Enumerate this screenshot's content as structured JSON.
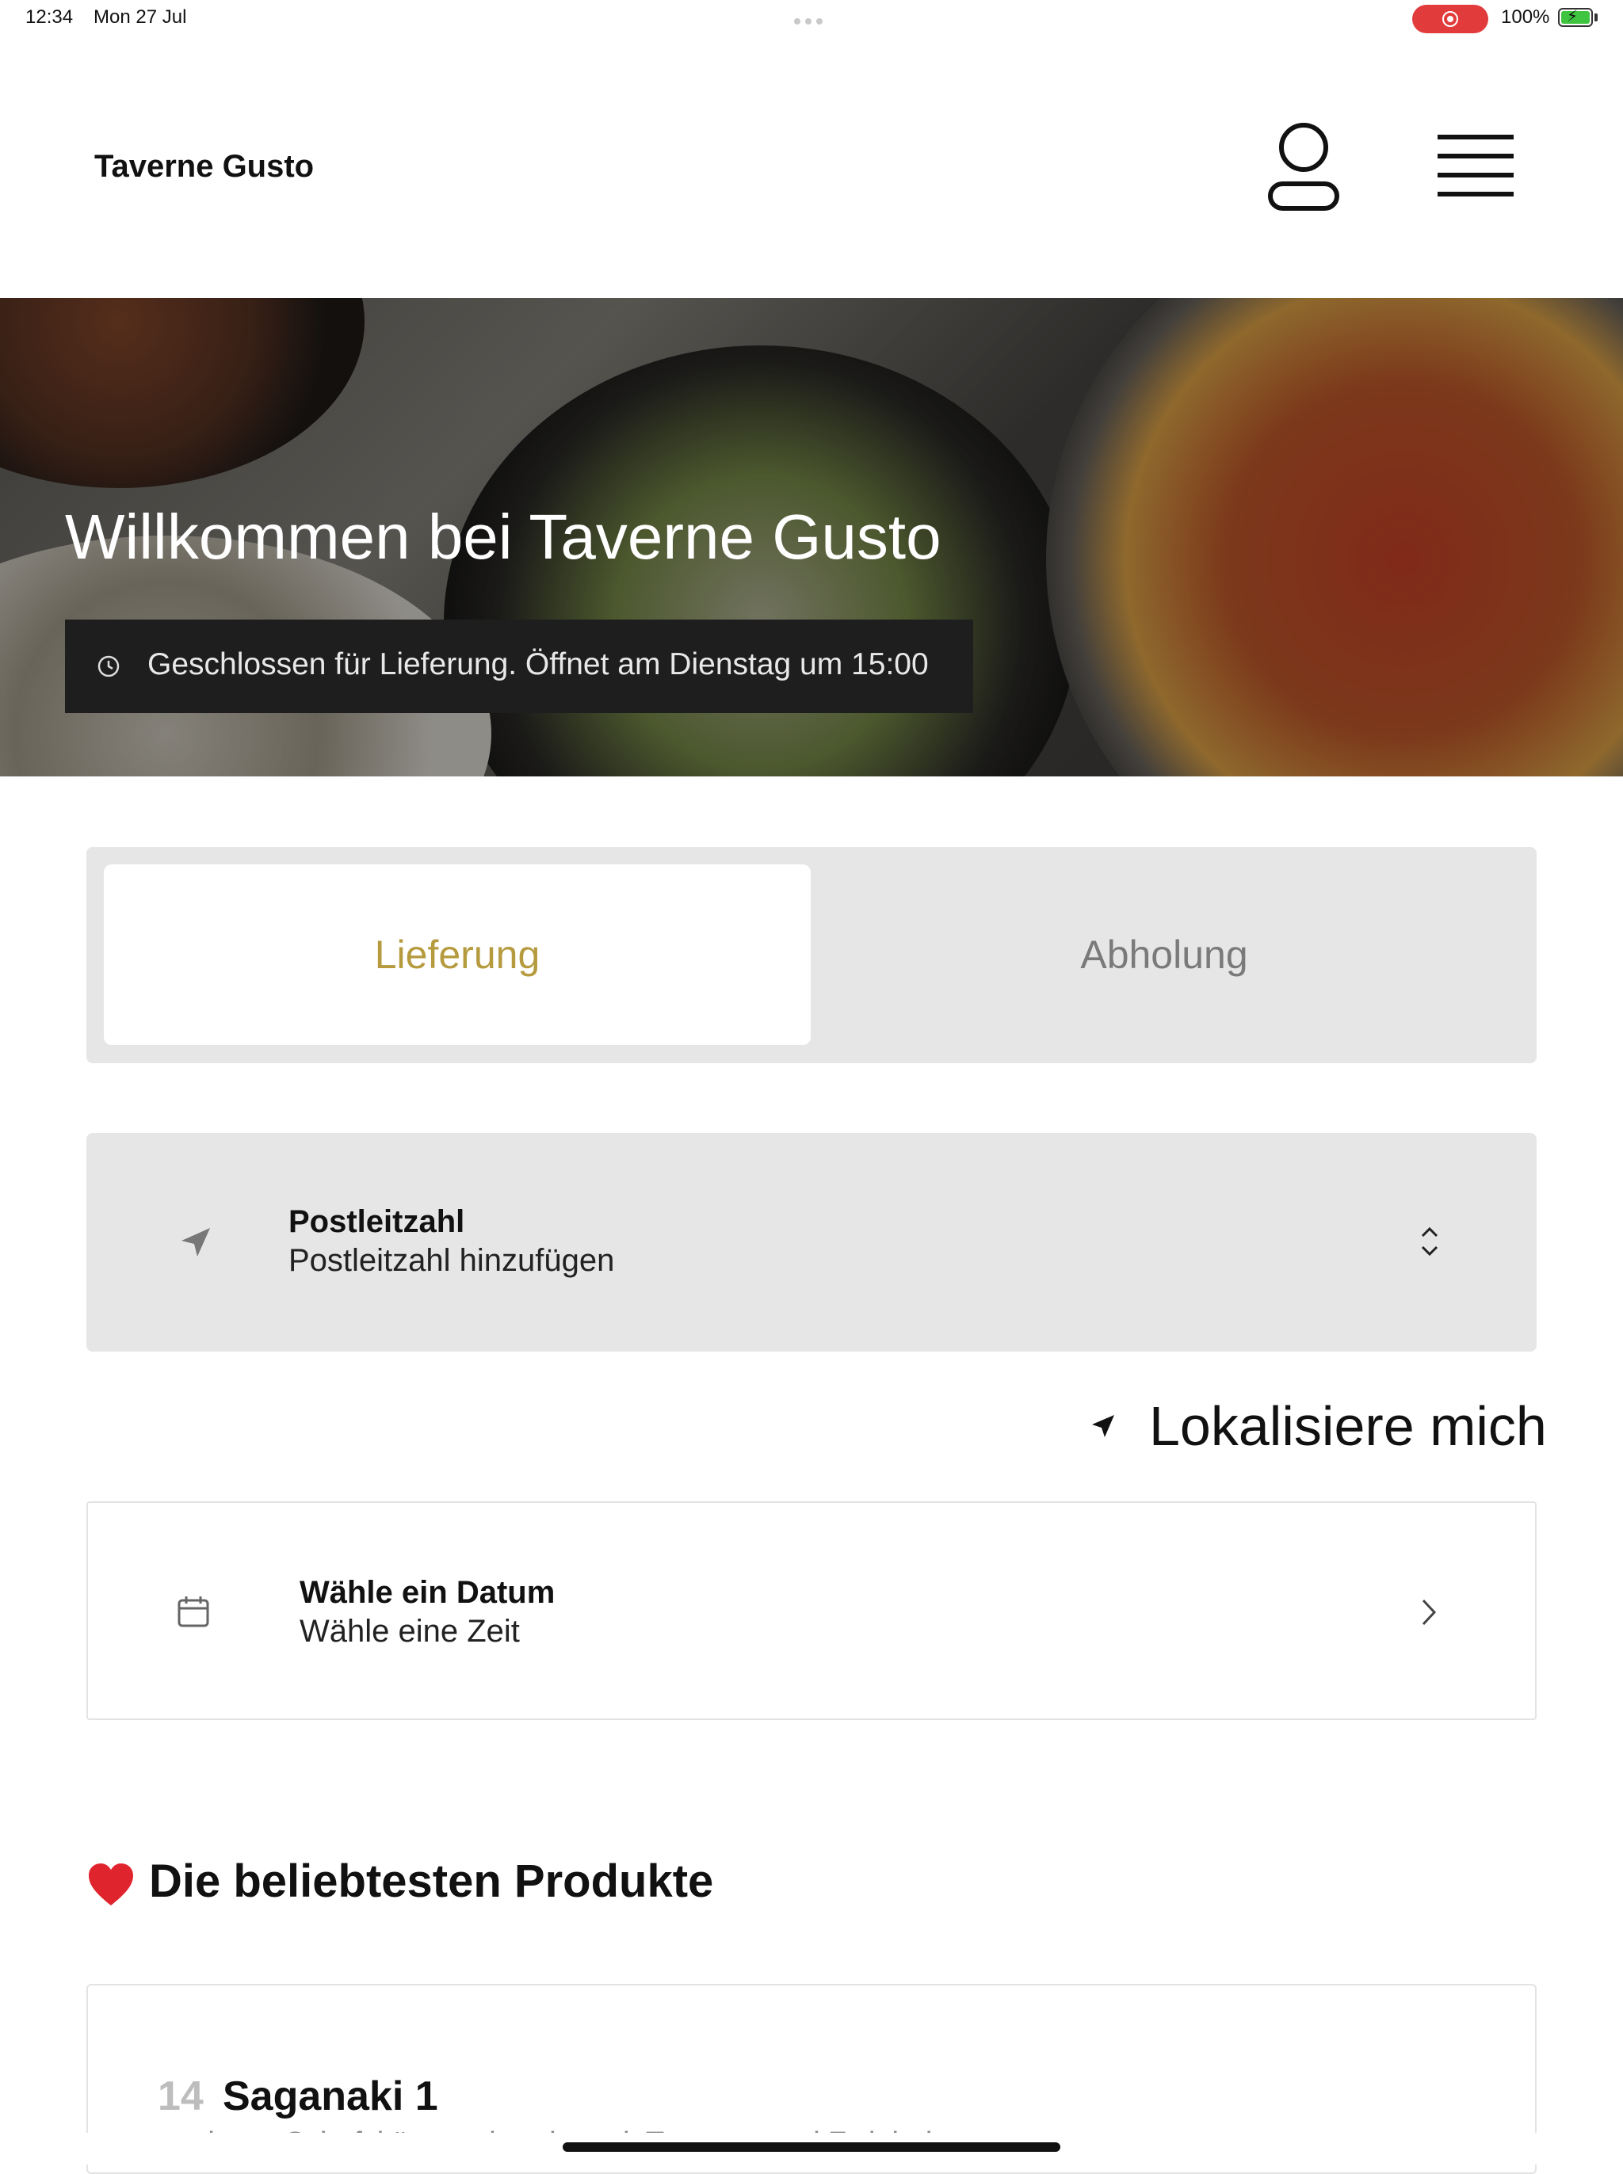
{
  "status_bar": {
    "time": "12:34",
    "date": "Mon 27 Jul",
    "battery": "100%"
  },
  "header": {
    "brand": "Taverne Gusto",
    "account_icon": "user-icon",
    "menu_icon": "hamburger-menu-icon"
  },
  "hero": {
    "title": "Willkommen bei Taverne Gusto",
    "closed_notice": "Geschlossen für Lieferung. Öffnet am Dienstag um 15:00"
  },
  "order_mode": {
    "options": [
      "Lieferung",
      "Abholung"
    ],
    "selected": "Lieferung",
    "active_color": "#b59b3e"
  },
  "postcode": {
    "title": "Postleitzahl",
    "value": "Postleitzahl hinzufügen"
  },
  "locate": {
    "label": "Lokalisiere mich"
  },
  "date_picker": {
    "title": "Wähle ein Datum",
    "subtitle": "Wähle eine Zeit"
  },
  "popular": {
    "heading": "Die beliebtesten Produkte",
    "products": [
      {
        "number": "14",
        "name": "Saganaki 1",
        "description": "panierter Schafskäse, zubereitet mit Tomaten und Zwiebeln"
      }
    ]
  }
}
